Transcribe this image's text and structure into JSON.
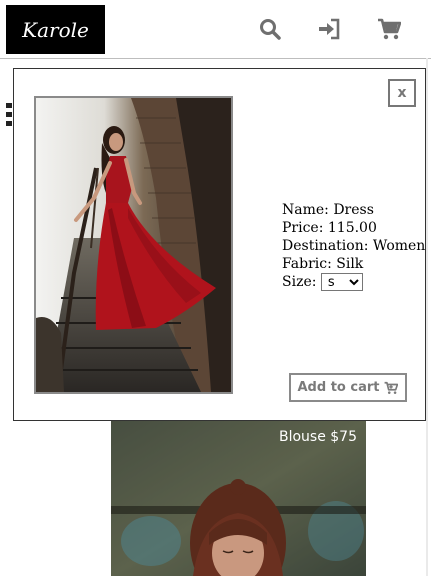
{
  "header": {
    "logo_text": "Karole",
    "icons": [
      "search-icon",
      "login-icon",
      "cart-icon"
    ]
  },
  "product_card": {
    "caption": "Blouse $75"
  },
  "modal": {
    "close_label": "x",
    "details": {
      "name": "Name: Dress",
      "price": "Price: 115.00",
      "destination": "Destination: Women",
      "fabric": "Fabric: Silk",
      "size_label": "Size:",
      "size_value": "s"
    },
    "add_to_cart_label": "Add to cart"
  },
  "colors": {
    "logo_bg": "#000000",
    "icon_gray": "#6f6f6f",
    "dress_red": "#b0131c"
  }
}
